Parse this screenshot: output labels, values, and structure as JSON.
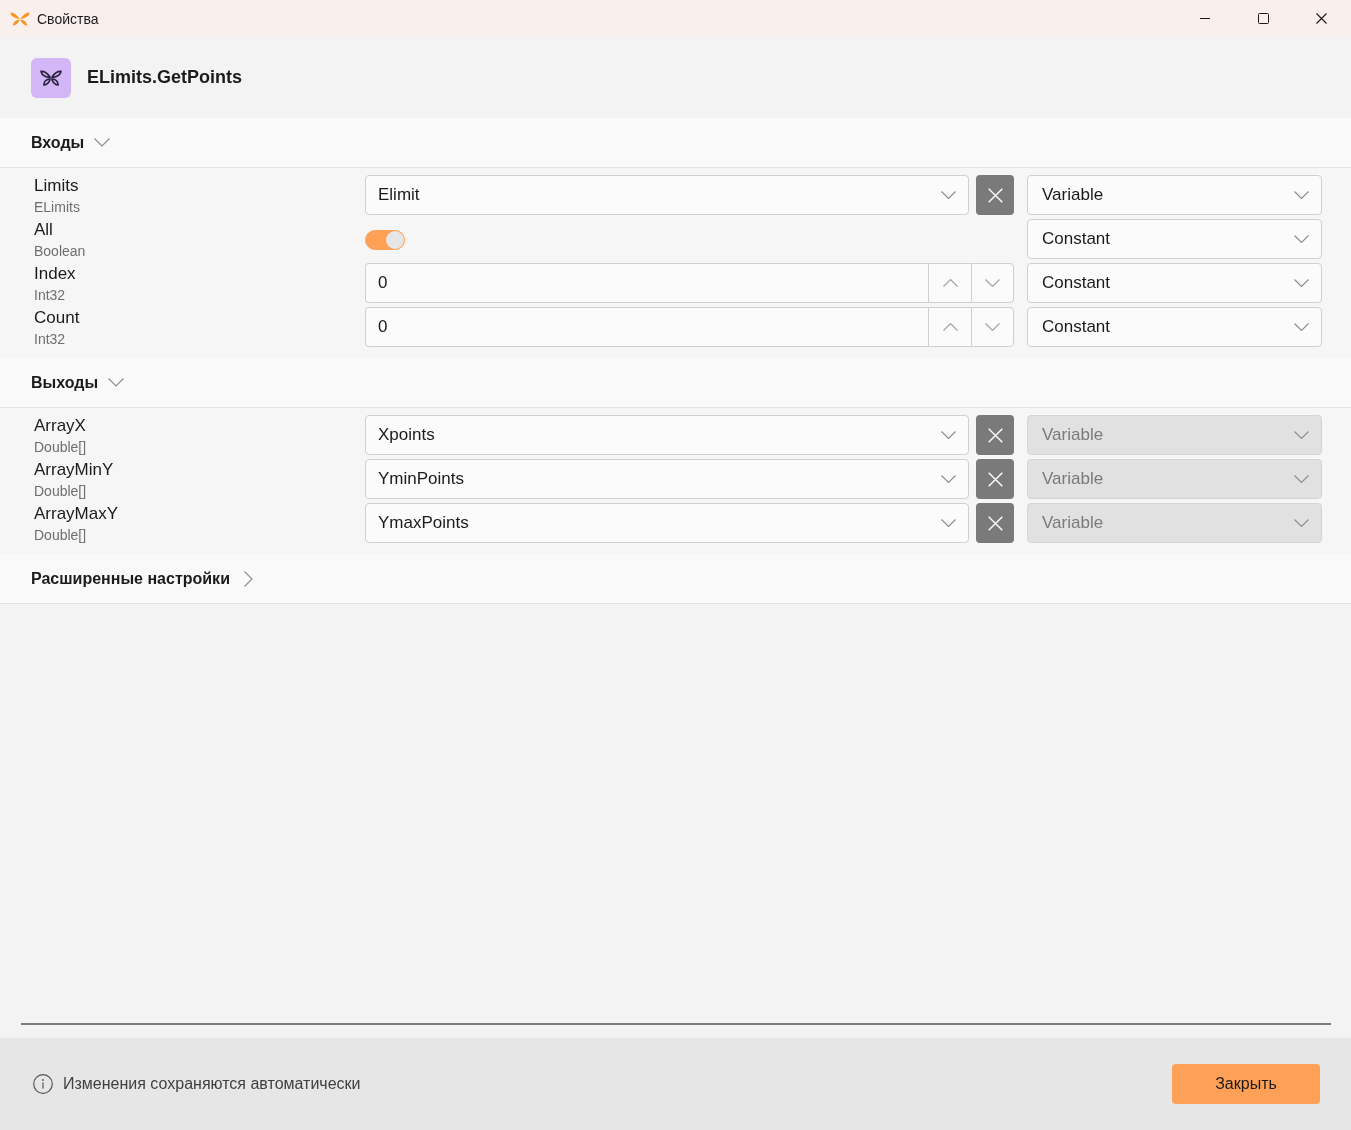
{
  "window": {
    "title": "Свойства"
  },
  "header": {
    "title": "ELimits.GetPoints"
  },
  "sections": [
    {
      "title": "Входы",
      "expanded": true,
      "rows": [
        {
          "name": "Limits",
          "type": "ELimits",
          "kind": "dropdown",
          "value": "Elimit",
          "mode": {
            "value": "Variable",
            "disabled": false
          }
        },
        {
          "name": "All",
          "type": "Boolean",
          "kind": "toggle",
          "on": true,
          "mode": {
            "value": "Constant",
            "disabled": false
          }
        },
        {
          "name": "Index",
          "type": "Int32",
          "kind": "number",
          "value": "0",
          "mode": {
            "value": "Constant",
            "disabled": false
          }
        },
        {
          "name": "Count",
          "type": "Int32",
          "kind": "number",
          "value": "0",
          "mode": {
            "value": "Constant",
            "disabled": false
          }
        }
      ]
    },
    {
      "title": "Выходы",
      "expanded": true,
      "rows": [
        {
          "name": "ArrayX",
          "type": "Double[]",
          "kind": "dropdown",
          "value": "Xpoints",
          "mode": {
            "value": "Variable",
            "disabled": true
          }
        },
        {
          "name": "ArrayMinY",
          "type": "Double[]",
          "kind": "dropdown",
          "value": "YminPoints",
          "mode": {
            "value": "Variable",
            "disabled": true
          }
        },
        {
          "name": "ArrayMaxY",
          "type": "Double[]",
          "kind": "dropdown",
          "value": "YmaxPoints",
          "mode": {
            "value": "Variable",
            "disabled": true
          }
        }
      ]
    },
    {
      "title": "Расширенные настройки",
      "expanded": false
    }
  ],
  "footer": {
    "info": "Изменения сохраняются автоматически",
    "close_button": "Закрыть"
  }
}
